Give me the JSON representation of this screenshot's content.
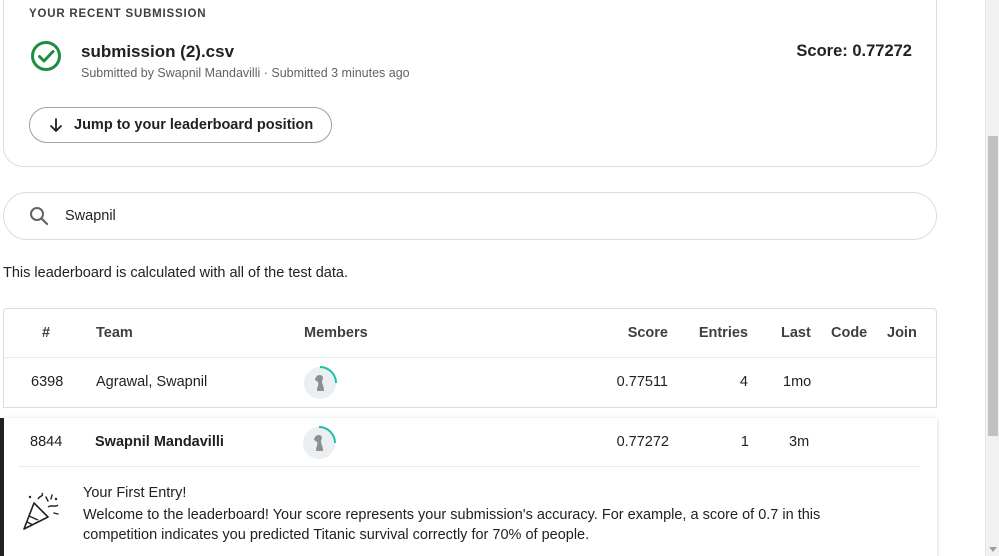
{
  "submission": {
    "section_label": "YOUR RECENT SUBMISSION",
    "filename": "submission (2).csv",
    "meta": "Submitted by Swapnil Mandavilli · Submitted 3 minutes ago",
    "score": "Score: 0.77272",
    "jump_label": "Jump to your leaderboard position",
    "status_color": "#1e8e3e"
  },
  "search": {
    "value": "Swapnil",
    "icon": "search-icon"
  },
  "leaderboard": {
    "note": "This leaderboard is calculated with all of the test data.",
    "columns": {
      "rank": "#",
      "team": "Team",
      "members": "Members",
      "score": "Score",
      "entries": "Entries",
      "last": "Last",
      "code": "Code",
      "join": "Join"
    },
    "rows": [
      {
        "rank": "6398",
        "team": "Agrawal, Swapnil",
        "score": "0.77511",
        "entries": "4",
        "last": "1mo"
      }
    ],
    "own_row": {
      "rank": "8844",
      "team": "Swapnil Mandavilli",
      "score": "0.77272",
      "entries": "1",
      "last": "3m"
    }
  },
  "first_entry": {
    "title": "Your First Entry!",
    "text": "Welcome to the leaderboard! Your score represents your submission's accuracy. For example, a score of 0.7 in this competition indicates you predicted Titanic survival correctly for 70% of people.",
    "icon": "confetti-icon"
  },
  "colors": {
    "accent_green": "#1e8e3e",
    "avatar_ring": "#20beff"
  }
}
